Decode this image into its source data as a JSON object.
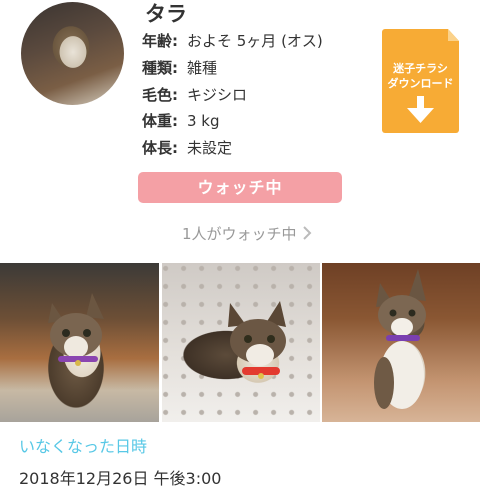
{
  "pet": {
    "name": "タラ",
    "info": [
      {
        "key": "年齢:",
        "value": "およそ 5ヶ月 (オス)"
      },
      {
        "key": "種類:",
        "value": "雑種"
      },
      {
        "key": "毛色:",
        "value": "キジシロ"
      },
      {
        "key": "体重:",
        "value": "3 kg"
      },
      {
        "key": "体長:",
        "value": "未設定"
      }
    ]
  },
  "flyer": {
    "line1": "迷子チラシ",
    "line2": "ダウンロード"
  },
  "watch": {
    "button_label": "ウォッチ中",
    "count_text": "1人がウォッチ中"
  },
  "missing": {
    "section_title": "いなくなった日時",
    "datetime": "2018年12月26日 午後3:00"
  },
  "colors": {
    "flyer_bg": "#f7ab35",
    "watch_button_bg": "#f4a0a5",
    "section_title": "#58c8e6"
  },
  "icons": {
    "flyer_arrow": "down-arrow-icon",
    "watch_chevron": "chevron-right-icon"
  }
}
